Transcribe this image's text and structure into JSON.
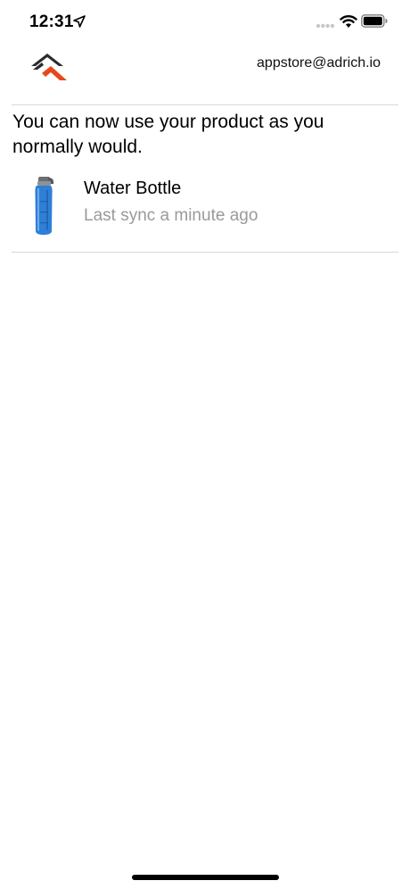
{
  "status_bar": {
    "time": "12:31",
    "icons": [
      "location-arrow-icon",
      "cellular-signal-icon",
      "wifi-icon",
      "battery-icon"
    ]
  },
  "header": {
    "logo": "adrich-logo",
    "account_email": "appstore@adrich.io"
  },
  "main": {
    "message": "You can now use your product as you normally would.",
    "devices": [
      {
        "name": "Water Bottle",
        "sync_status": "Last sync a minute ago",
        "image": "water-bottle-image"
      }
    ]
  },
  "colors": {
    "brand_dark": "#2b2b2b",
    "brand_accent": "#e8481c",
    "muted_text": "#9a9a9a",
    "divider": "#d9d9d9",
    "bottle_blue": "#2f7fd6"
  }
}
